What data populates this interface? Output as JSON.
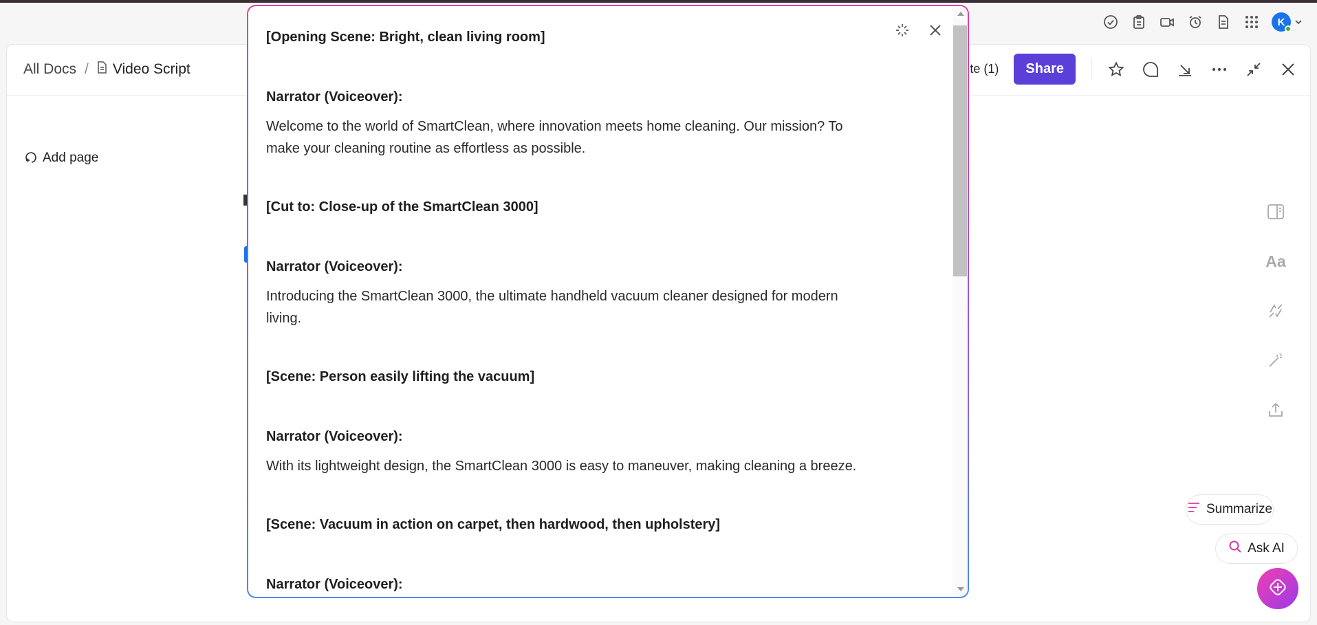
{
  "header": {
    "breadcrumb_root": "All Docs",
    "breadcrumb_separator": "/",
    "doc_title": "Video Script",
    "update_label": "te (1)",
    "share_label": "Share"
  },
  "topbar": {
    "avatar_initial": "K",
    "icons": [
      "check-circle-icon",
      "clipboard-icon",
      "video-icon",
      "alarm-icon",
      "document-icon",
      "apps-grid-icon"
    ]
  },
  "sidebar": {
    "add_page_label": "Add page"
  },
  "assistant": {
    "summarize_label": "Summarize",
    "ask_ai_label": "Ask AI"
  },
  "modal": {
    "blocks": [
      {
        "type": "scene",
        "text": "[Opening Scene: Bright, clean living room]"
      },
      {
        "type": "narrator",
        "text": "Narrator (Voiceover):"
      },
      {
        "type": "body",
        "text": "Welcome to the world of SmartClean, where innovation meets home cleaning. Our mission? To make your cleaning routine as effortless as possible."
      },
      {
        "type": "scene",
        "text": "[Cut to: Close-up of the SmartClean 3000]"
      },
      {
        "type": "narrator",
        "text": "Narrator (Voiceover):"
      },
      {
        "type": "body",
        "text": "Introducing the SmartClean 3000, the ultimate handheld vacuum cleaner designed for modern living."
      },
      {
        "type": "scene",
        "text": "[Scene: Person easily lifting the vacuum]"
      },
      {
        "type": "narrator",
        "text": "Narrator (Voiceover):"
      },
      {
        "type": "body",
        "text": "With its lightweight design, the SmartClean 3000 is easy to maneuver, making cleaning a breeze."
      },
      {
        "type": "scene",
        "text": "[Scene: Vacuum in action on carpet, then hardwood, then upholstery]"
      },
      {
        "type": "narrator",
        "text": "Narrator (Voiceover):"
      }
    ]
  },
  "colors": {
    "brand_purple": "#5b3fd8",
    "avatar_blue": "#1a73e8",
    "status_green": "#2fb344",
    "ai_gradient_start": "#f03fb0",
    "ai_gradient_end": "#9b3be8"
  }
}
